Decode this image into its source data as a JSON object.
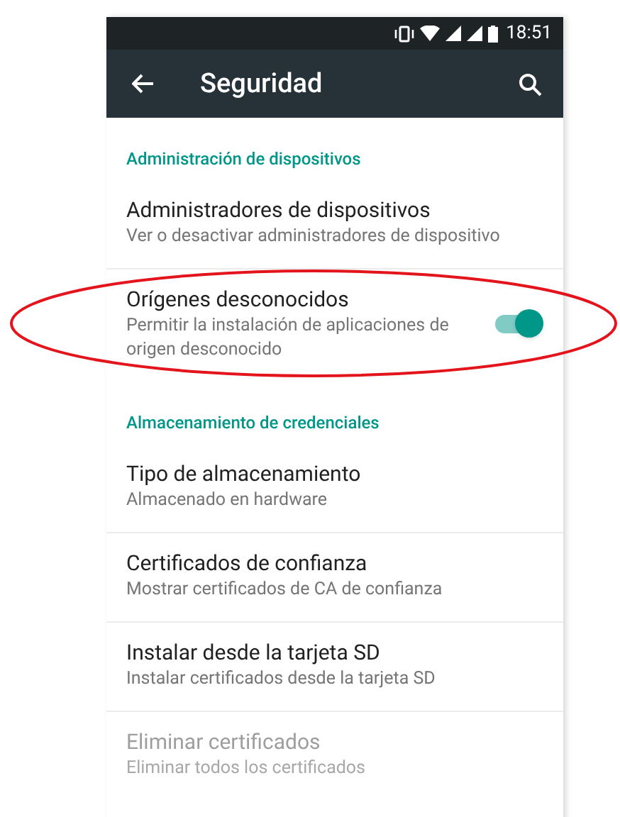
{
  "status_bar": {
    "time": "18:51"
  },
  "app_bar": {
    "title": "Seguridad"
  },
  "sections": [
    {
      "header": "Administración de dispositivos",
      "items": [
        {
          "kind": "plain",
          "title": "Administradores de dispositivos",
          "summary": "Ver o desactivar administradores de dispositivo",
          "disabled": false
        },
        {
          "kind": "toggle",
          "title": "Orígenes desconocidos",
          "summary": "Permitir la instalación de aplicaciones de origen desconocido",
          "disabled": false,
          "on": true
        }
      ]
    },
    {
      "header": "Almacenamiento de credenciales",
      "items": [
        {
          "kind": "plain",
          "title": "Tipo de almacenamiento",
          "summary": "Almacenado en hardware",
          "disabled": false
        },
        {
          "kind": "plain",
          "title": "Certificados de confianza",
          "summary": "Mostrar certificados de CA de confianza",
          "disabled": false
        },
        {
          "kind": "plain",
          "title": "Instalar desde la tarjeta SD",
          "summary": "Instalar certificados desde la tarjeta SD",
          "disabled": false
        },
        {
          "kind": "plain",
          "title": "Eliminar certificados",
          "summary": "Eliminar todos los certificados",
          "disabled": true
        }
      ]
    }
  ]
}
